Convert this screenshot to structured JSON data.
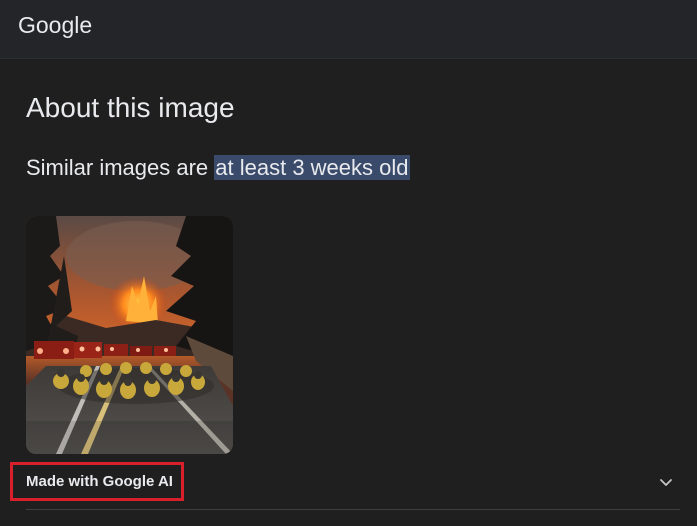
{
  "header": {
    "logo_text": "Google"
  },
  "main": {
    "title": "About this image",
    "subtitle_prefix": "Similar images are ",
    "subtitle_highlight": "at least 3 weeks old",
    "thumbnail": {
      "description_icon": "image-thumbnail"
    },
    "made_with": {
      "label": "Made with Google AI",
      "expand_icon": "chevron-down-icon"
    }
  },
  "colors": {
    "background": "#1f1f1f",
    "header_background": "#242528",
    "highlight": "#3a4a6b",
    "annotation_box": "#d8202c"
  }
}
